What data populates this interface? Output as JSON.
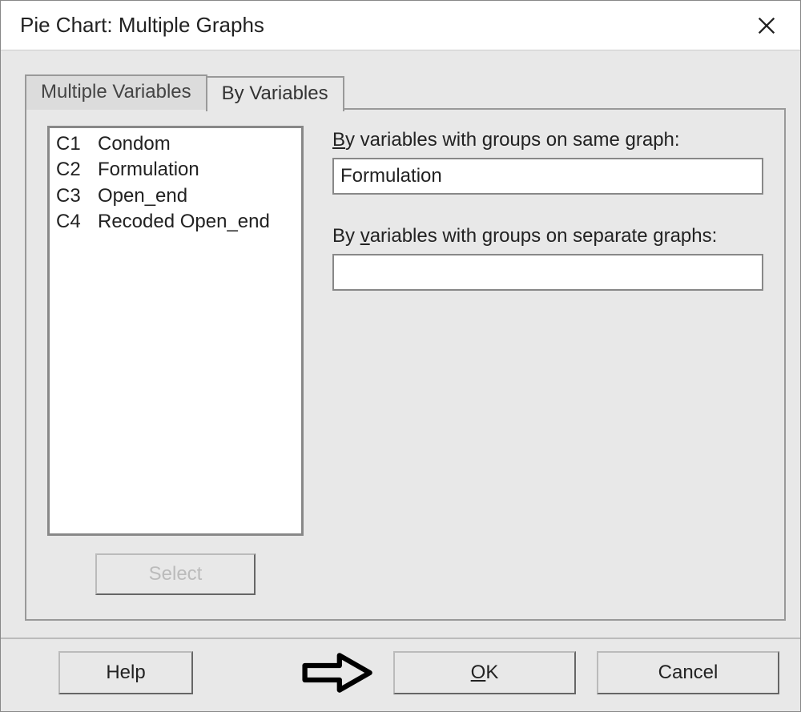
{
  "dialog": {
    "title": "Pie Chart: Multiple Graphs"
  },
  "tabs": {
    "multiple_variables": "Multiple Variables",
    "by_variables": "By Variables",
    "active": "by_variables"
  },
  "variables": [
    {
      "col": "C1",
      "name": "Condom"
    },
    {
      "col": "C2",
      "name": "Formulation"
    },
    {
      "col": "C3",
      "name": "Open_end"
    },
    {
      "col": "C4",
      "name": "Recoded Open_end"
    }
  ],
  "fields": {
    "same_graph": {
      "label_prefix": "B",
      "label_rest": "y variables with groups on same graph:",
      "value": "Formulation"
    },
    "separate_graphs": {
      "label_prefix": "By ",
      "label_underline": "v",
      "label_rest": "ariables with groups on separate graphs:",
      "value": ""
    }
  },
  "buttons": {
    "select": "Select",
    "help": "Help",
    "ok_underline": "O",
    "ok_rest": "K",
    "cancel": "Cancel"
  }
}
